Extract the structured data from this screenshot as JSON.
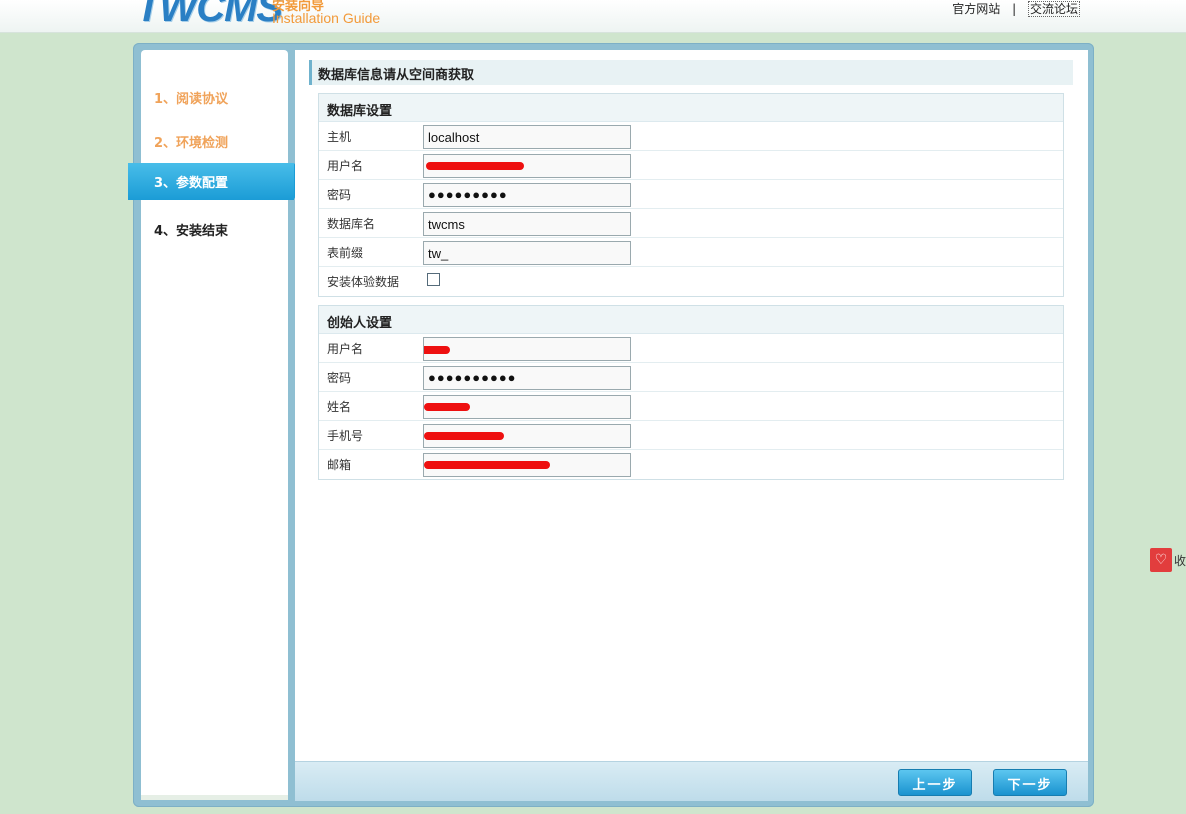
{
  "header": {
    "logo_text": "TWCMS",
    "guide_cn": "安装向导",
    "guide_en": "Installation Guide",
    "links": [
      "官方网站",
      "|",
      "交流论坛"
    ]
  },
  "steps": [
    {
      "label": "1、阅读协议",
      "state": "done"
    },
    {
      "label": "2、环境检测",
      "state": "done"
    },
    {
      "label": "3、参数配置",
      "state": "active"
    },
    {
      "label": "4、安装结束",
      "state": "todo"
    }
  ],
  "page_title": "数据库信息请从空间商获取",
  "db_section": {
    "title": "数据库设置",
    "rows": [
      {
        "label": "主机",
        "value": "localhost"
      },
      {
        "label": "用户名",
        "value": ""
      },
      {
        "label": "密码",
        "value": "●●●●●●●●●"
      },
      {
        "label": "数据库名",
        "value": "twcms"
      },
      {
        "label": "表前缀",
        "value": "tw_"
      },
      {
        "label": "安装体验数据",
        "value": ""
      }
    ]
  },
  "founder_section": {
    "title": "创始人设置",
    "rows": [
      {
        "label": "用户名",
        "value": ""
      },
      {
        "label": "密码",
        "value": "●●●●●●●●●●"
      },
      {
        "label": "姓名",
        "value": ""
      },
      {
        "label": "手机号",
        "value": ""
      },
      {
        "label": "邮箱",
        "value": ""
      }
    ]
  },
  "buttons": {
    "prev": "上一步",
    "next": "下一步"
  },
  "collect_widget": {
    "icon": "heart-icon",
    "label": "收"
  },
  "colors": {
    "accent": "#1b9cd6",
    "done_step": "#f0a35a",
    "redaction": "#ee1010"
  }
}
